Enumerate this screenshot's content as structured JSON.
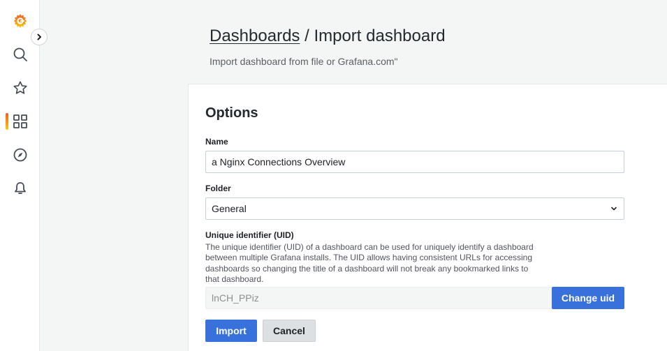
{
  "sidebar": {
    "items": [
      {
        "icon": "grafana-logo-icon"
      },
      {
        "icon": "search-icon"
      },
      {
        "icon": "star-icon"
      },
      {
        "icon": "dashboards-icon",
        "active": true
      },
      {
        "icon": "explore-compass-icon"
      },
      {
        "icon": "alerting-bell-icon"
      }
    ],
    "collapse_icon": "chevron-right-icon"
  },
  "header": {
    "breadcrumb_link": "Dashboards",
    "separator": " / ",
    "title": "Import dashboard",
    "subtitle": "Import dashboard from file or Grafana.com\""
  },
  "options": {
    "title": "Options",
    "name_label": "Name",
    "name_value": "a Nginx Connections Overview",
    "folder_label": "Folder",
    "folder_value": "General",
    "uid_label": "Unique identifier (UID)",
    "uid_description": "The unique identifier (UID) of a dashboard can be used for uniquely identify a dashboard between multiple Grafana installs. The UID allows having consistent URLs for accessing dashboards so changing the title of a dashboard will not break any bookmarked links to that dashboard.",
    "uid_value": "lnCH_PPiz",
    "change_uid_label": "Change uid",
    "import_label": "Import",
    "cancel_label": "Cancel"
  },
  "colors": {
    "accent": "#3871dc",
    "active_gradient_start": "#f05a28",
    "active_gradient_end": "#fbca0a"
  }
}
